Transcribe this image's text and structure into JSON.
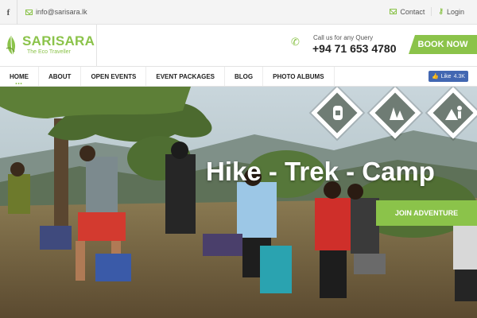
{
  "topbar": {
    "facebook_icon": "f",
    "email": "info@sarisara.lk",
    "contact_label": "Contact",
    "login_label": "Login"
  },
  "header": {
    "logo_name": "SARISARA",
    "logo_tagline": "The Eco Traveller",
    "call_label": "Call us for any Query",
    "phone": "+94 71 653 4780",
    "book_label": "BOOK NOW"
  },
  "nav": {
    "items": [
      {
        "label": "HOME"
      },
      {
        "label": "ABOUT"
      },
      {
        "label": "OPEN EVENTS"
      },
      {
        "label": "EVENT PACKAGES"
      },
      {
        "label": "BLOG"
      },
      {
        "label": "PHOTO ALBUMS"
      }
    ],
    "like_label": "Like",
    "like_count": "4.3K"
  },
  "hero": {
    "headline": "Hike - Trek - Camp",
    "join_label": "JOIN ADVENTURE",
    "icons": [
      "backpack-icon",
      "trees-icon",
      "camping-icon"
    ]
  },
  "colors": {
    "accent": "#8bc34a",
    "facebook": "#4267b2"
  }
}
